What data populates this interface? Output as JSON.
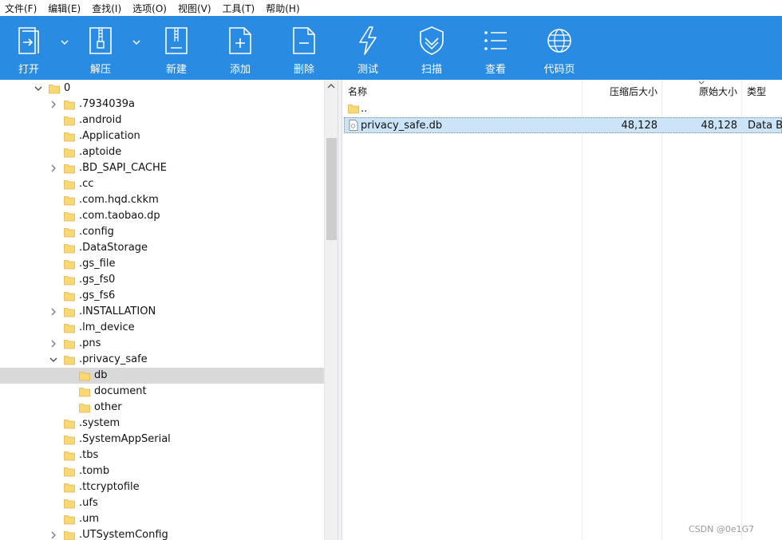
{
  "menu": [
    "文件(F)",
    "编辑(E)",
    "查找(I)",
    "选项(O)",
    "视图(V)",
    "工具(T)",
    "帮助(H)"
  ],
  "toolbar": {
    "open": "打开",
    "extract": "解压",
    "new": "新建",
    "add": "添加",
    "delete": "删除",
    "test": "测试",
    "scan": "扫描",
    "view": "查看",
    "codepage": "代码页"
  },
  "tree": [
    {
      "label": "0",
      "expander": "down"
    },
    {
      "label": ".7934039a",
      "expander": "right"
    },
    {
      "label": ".android",
      "expander": ""
    },
    {
      "label": ".Application",
      "expander": ""
    },
    {
      "label": ".aptoide",
      "expander": ""
    },
    {
      "label": ".BD_SAPI_CACHE",
      "expander": "right"
    },
    {
      "label": ".cc",
      "expander": ""
    },
    {
      "label": ".com.hqd.ckkm",
      "expander": ""
    },
    {
      "label": ".com.taobao.dp",
      "expander": ""
    },
    {
      "label": ".config",
      "expander": ""
    },
    {
      "label": ".DataStorage",
      "expander": ""
    },
    {
      "label": ".gs_file",
      "expander": ""
    },
    {
      "label": ".gs_fs0",
      "expander": ""
    },
    {
      "label": ".gs_fs6",
      "expander": ""
    },
    {
      "label": ".INSTALLATION",
      "expander": "right"
    },
    {
      "label": ".lm_device",
      "expander": ""
    },
    {
      "label": ".pns",
      "expander": "right"
    },
    {
      "label": ".privacy_safe",
      "expander": "down"
    },
    {
      "label": "db",
      "expander": "",
      "selected": true
    },
    {
      "label": "document",
      "expander": ""
    },
    {
      "label": "other",
      "expander": ""
    },
    {
      "label": ".system",
      "expander": ""
    },
    {
      "label": ".SystemAppSerial",
      "expander": ""
    },
    {
      "label": ".tbs",
      "expander": ""
    },
    {
      "label": ".tomb",
      "expander": ""
    },
    {
      "label": ".ttcryptofile",
      "expander": ""
    },
    {
      "label": ".ufs",
      "expander": ""
    },
    {
      "label": ".um",
      "expander": ""
    },
    {
      "label": ".UTSystemConfig",
      "expander": "right"
    }
  ],
  "list": {
    "headers": {
      "name": "名称",
      "packed": "压缩后大小",
      "size": "原始大小",
      "type": "类型"
    },
    "rows": [
      {
        "name": "..",
        "packed": "",
        "size": "",
        "type": "",
        "icon": "folder-icon"
      },
      {
        "name": "privacy_safe.db",
        "packed": "48,128",
        "size": "48,128",
        "type": "Data Ba",
        "icon": "file-icon",
        "selected": true
      }
    ]
  },
  "watermark": "CSDN @0e1G7",
  "colors": {
    "toolbar": "#2a8be2",
    "folder": "#f8d775",
    "selected_tree": "#d9d9d9",
    "selected_list": "#cce4f7"
  }
}
